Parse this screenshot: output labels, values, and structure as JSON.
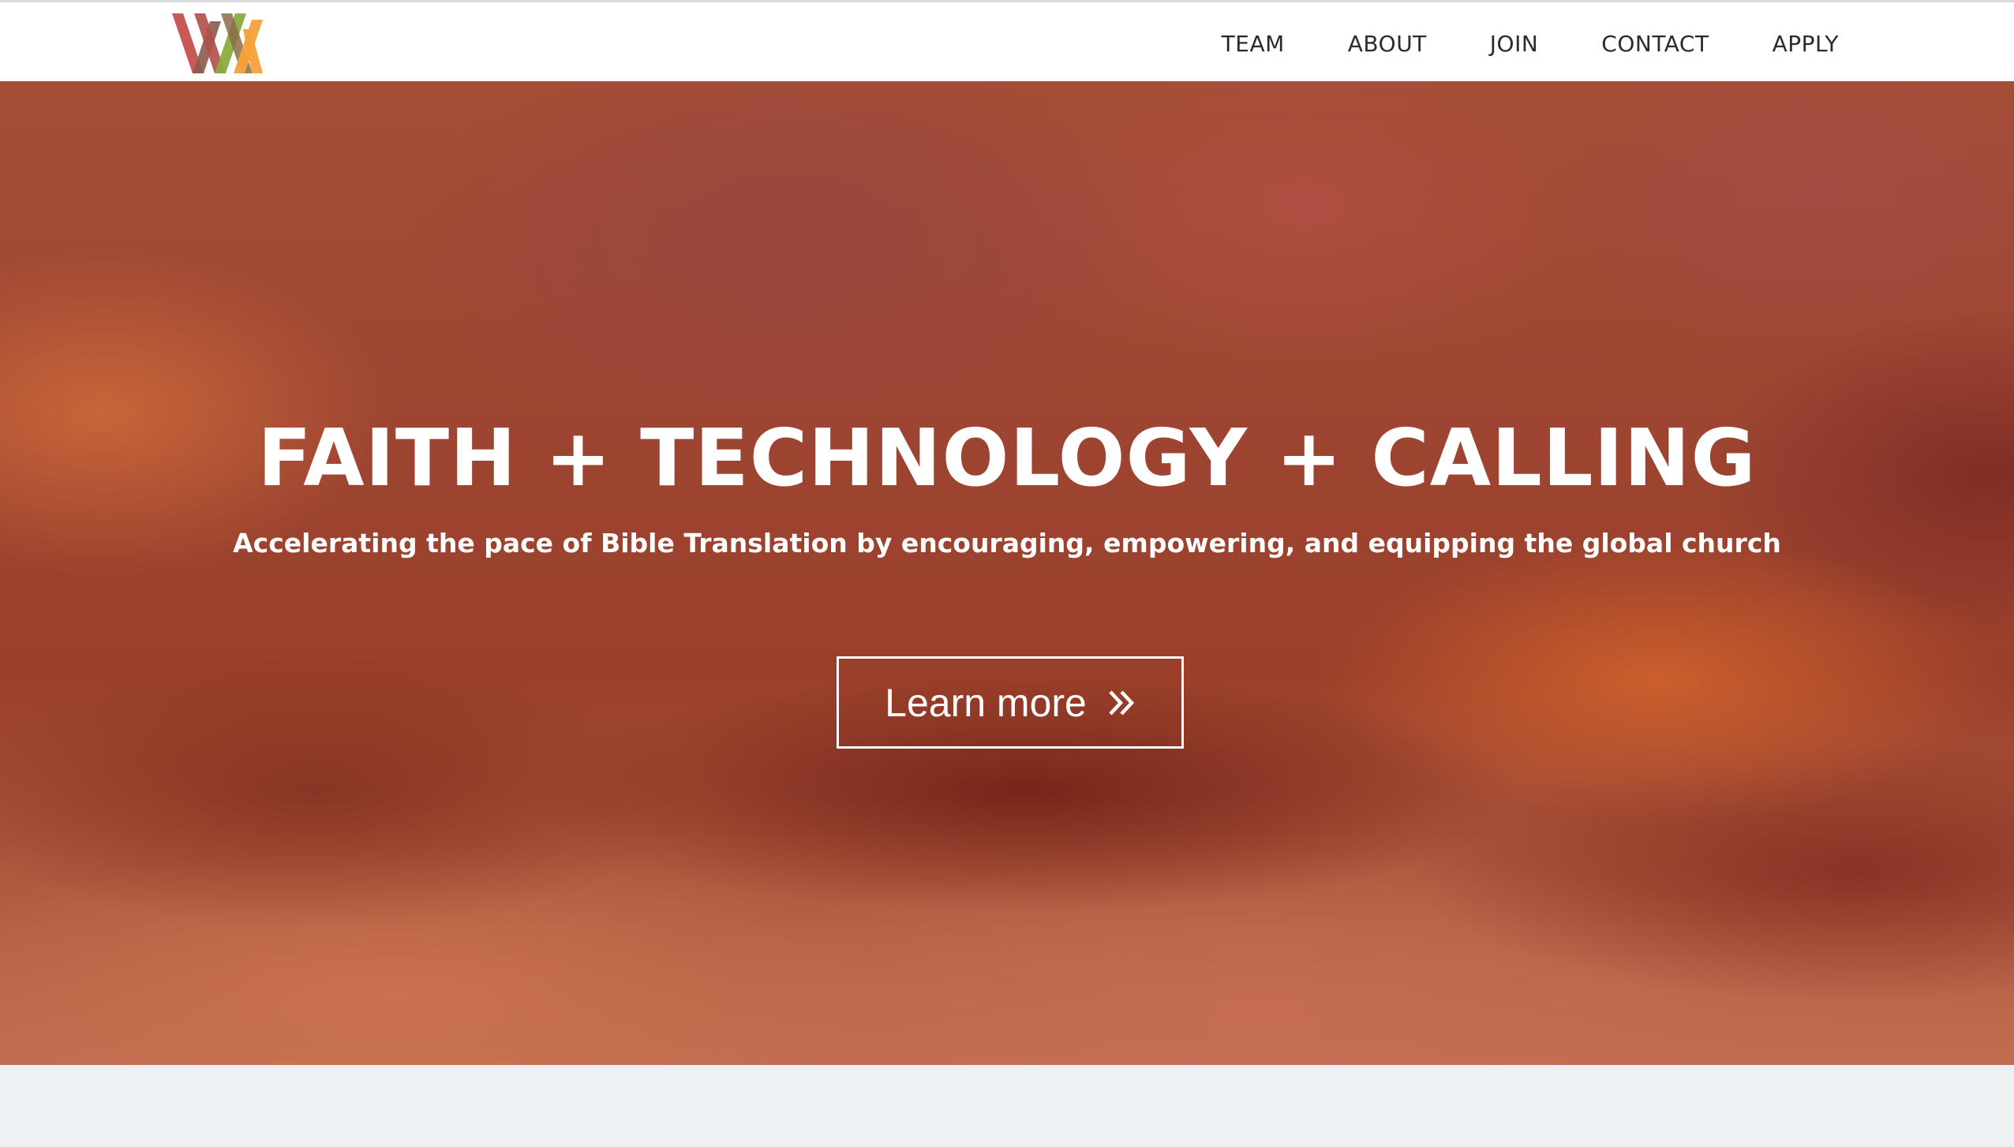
{
  "header": {
    "logo_name": "logo-icon",
    "nav": [
      {
        "label": "TEAM"
      },
      {
        "label": "ABOUT"
      },
      {
        "label": "JOIN"
      },
      {
        "label": "CONTACT"
      },
      {
        "label": "APPLY"
      }
    ]
  },
  "hero": {
    "title": "FAITH + TECHNOLOGY + CALLING",
    "subtitle": "Accelerating the pace of Bible Translation by encouraging, empowering, and equipping the global church",
    "cta_label": "Learn more",
    "cta_icon": "double-chevron-right-icon"
  },
  "colors": {
    "header_bg": "#ffffff",
    "nav_text": "#2b2b2b",
    "hero_base": "#a5503a",
    "hero_text": "#ffffff",
    "footer_bg": "#eef1f4",
    "logo_red": "#c4504e",
    "logo_brown": "#8c5a4a",
    "logo_green": "#8bab3e",
    "logo_orange": "#f5a13a"
  }
}
